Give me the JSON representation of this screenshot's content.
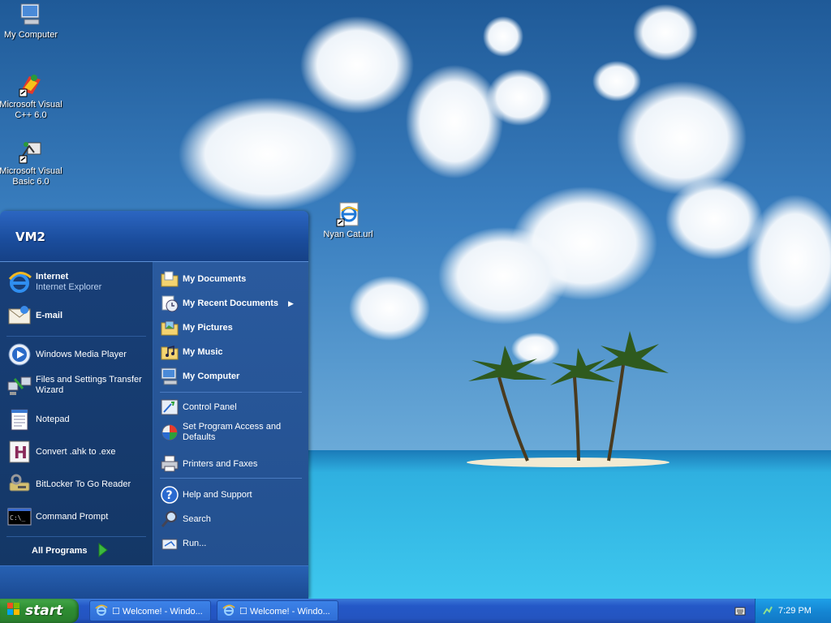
{
  "desktop": {
    "icons": [
      {
        "label": "My Computer",
        "icon": "my-computer-icon"
      },
      {
        "label": "Microsoft Visual C++ 6.0",
        "icon": "visual-cpp-icon"
      },
      {
        "label": "Microsoft Visual Basic 6.0",
        "icon": "visual-basic-icon"
      },
      {
        "label": "Nyan Cat.url",
        "icon": "internet-shortcut-icon"
      }
    ]
  },
  "start_menu": {
    "user_name": "VM2",
    "pinned": [
      {
        "label": "Internet",
        "sublabel": "Internet Explorer",
        "icon": "internet-explorer-icon"
      },
      {
        "label": "E-mail",
        "icon": "email-icon"
      }
    ],
    "recent_programs": [
      {
        "label": "Windows Media Player",
        "icon": "media-player-icon"
      },
      {
        "label": "Files and Settings Transfer Wizard",
        "icon": "transfer-wizard-icon"
      },
      {
        "label": "Notepad",
        "icon": "notepad-icon"
      },
      {
        "label": "Convert .ahk to .exe",
        "icon": "ahk-icon"
      },
      {
        "label": "BitLocker To Go Reader",
        "icon": "bitlocker-icon"
      },
      {
        "label": "Command Prompt",
        "icon": "command-prompt-icon"
      }
    ],
    "all_programs_label": "All Programs",
    "places": [
      {
        "label": "My Documents",
        "icon": "documents-folder-icon"
      },
      {
        "label": "My Recent Documents",
        "icon": "recent-documents-icon"
      },
      {
        "label": "My Pictures",
        "icon": "pictures-folder-icon"
      },
      {
        "label": "My Music",
        "icon": "music-folder-icon"
      },
      {
        "label": "My Computer",
        "icon": "my-computer-icon"
      }
    ],
    "settings": [
      {
        "label": "Control Panel",
        "icon": "control-panel-icon"
      },
      {
        "label": "Set Program Access and Defaults",
        "icon": "program-access-icon"
      },
      {
        "label": "Printers and Faxes",
        "icon": "printer-icon"
      }
    ],
    "tools": [
      {
        "label": "Help and Support",
        "icon": "help-icon"
      },
      {
        "label": "Search",
        "icon": "search-icon"
      },
      {
        "label": "Run...",
        "icon": "run-icon"
      }
    ]
  },
  "taskbar": {
    "start_label": "start",
    "tasks": [
      {
        "label": "☐ Welcome! - Windo..."
      },
      {
        "label": "☐ Welcome! - Windo..."
      }
    ],
    "clock": "7:29 PM"
  },
  "colors": {
    "taskbar_blue": "#2458c7",
    "start_green": "#2e8e32",
    "tray_blue": "#1587d4",
    "start_menu_left": "#183f78",
    "start_menu_right": "#2a5a9e"
  }
}
